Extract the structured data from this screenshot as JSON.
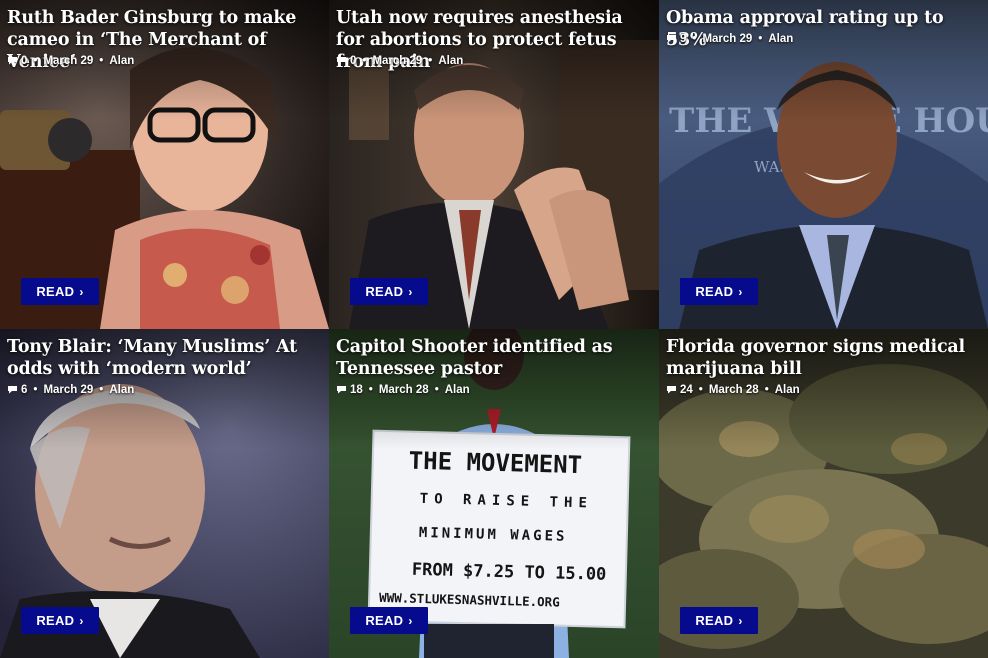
{
  "articles": [
    {
      "title": "Ruth Bader Ginsburg to make cameo in ‘The Merchant of Venice’",
      "comments": "0",
      "date": "March 29",
      "author": "Alan",
      "read_label": "READ",
      "photo": "portrait of Ruth Bader Ginsburg at a podium"
    },
    {
      "title": "Utah now requires anesthesia for abortions to protect fetus from pain",
      "comments": "0",
      "date": "March 29",
      "author": "Alan",
      "read_label": "READ",
      "photo": "man in suit speaking with hands pressed together"
    },
    {
      "title": "Obama approval rating up to 53%",
      "comments": "9",
      "date": "March 29",
      "author": "Alan",
      "read_label": "READ",
      "photo": "Barack Obama smiling in the White House briefing room"
    },
    {
      "title": "Tony Blair: ‘Many Muslims’ At odds with ‘modern world’",
      "comments": "6",
      "date": "March 29",
      "author": "Alan",
      "read_label": "READ",
      "photo": "close-up of Tony Blair"
    },
    {
      "title": "Capitol Shooter identified as Tennessee pastor",
      "comments": "18",
      "date": "March 28",
      "author": "Alan",
      "read_label": "READ",
      "photo": "man holding a protest sign outdoors"
    },
    {
      "title": "Florida governor signs medical marijuana bill",
      "comments": "24",
      "date": "March 28",
      "author": "Alan",
      "read_label": "READ",
      "photo": "close-up of cannabis buds"
    }
  ],
  "protest_sign": {
    "line1": "THE MOVEMENT",
    "line2": "TO RAISE THE",
    "line3": "MINIMUM WAGES",
    "line4": "FROM $7.25 TO 15.00",
    "line5": "WWW.STLUKESNASHVILLE.ORG"
  },
  "backdrop_text": "THE WHITE HOUSE",
  "backdrop_subtext": "WASHINGTON",
  "separator": "•",
  "icons": {
    "comments": "comment-bubble-icon",
    "read": "chevron-right-icon"
  }
}
